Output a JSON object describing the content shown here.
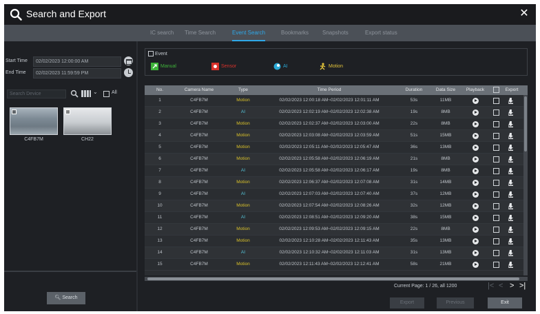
{
  "window": {
    "title": "Search and Export"
  },
  "tabs": [
    {
      "label": "IC search"
    },
    {
      "label": "Time Search"
    },
    {
      "label": "Event Search"
    },
    {
      "label": "Bookmarks"
    },
    {
      "label": "Snapshots"
    },
    {
      "label": "Export status"
    }
  ],
  "active_tab_index": 2,
  "filters": {
    "start_time_label": "Start Time",
    "start_time_value": "02/02/2023 12:00:00 AM",
    "end_time_label": "End Time",
    "end_time_value": "02/02/2023 11:59:59 PM",
    "search_placeholder": "Search Device",
    "all_label": "All"
  },
  "cameras": [
    {
      "name": "C4FB7M"
    },
    {
      "name": "CH22"
    }
  ],
  "search_button": "Search",
  "events": {
    "header": "Event",
    "items": [
      {
        "label": "Manual",
        "color": "#3fb43a"
      },
      {
        "label": "Sensor",
        "color": "#d8322b"
      },
      {
        "label": "AI",
        "color": "#2aa9d6"
      },
      {
        "label": "Motion",
        "color": "#e1c23a"
      }
    ]
  },
  "table": {
    "columns": [
      "No.",
      "Camera Name",
      "Type",
      "Time Period",
      "Duration",
      "Data Size",
      "Playback",
      "Export"
    ],
    "rows": [
      {
        "no": "1",
        "camera": "C4FB7M",
        "type": "Motion",
        "period": "02/02/2023 12:00:18 AM~02/02/2023 12:01:11 AM",
        "duration": "53s",
        "size": "11MB"
      },
      {
        "no": "2",
        "camera": "C4FB7M",
        "type": "AI",
        "period": "02/02/2023 12:02:19 AM~02/02/2023 12:02:38 AM",
        "duration": "19s",
        "size": "8MB"
      },
      {
        "no": "3",
        "camera": "C4FB7M",
        "type": "Motion",
        "period": "02/02/2023 12:02:37 AM~02/02/2023 12:03:00 AM",
        "duration": "22s",
        "size": "8MB"
      },
      {
        "no": "4",
        "camera": "C4FB7M",
        "type": "Motion",
        "period": "02/02/2023 12:03:08 AM~02/02/2023 12:03:59 AM",
        "duration": "51s",
        "size": "15MB"
      },
      {
        "no": "5",
        "camera": "C4FB7M",
        "type": "Motion",
        "period": "02/02/2023 12:05:11 AM~02/02/2023 12:05:47 AM",
        "duration": "36s",
        "size": "13MB"
      },
      {
        "no": "6",
        "camera": "C4FB7M",
        "type": "Motion",
        "period": "02/02/2023 12:05:58 AM~02/02/2023 12:06:19 AM",
        "duration": "21s",
        "size": "8MB"
      },
      {
        "no": "7",
        "camera": "C4FB7M",
        "type": "AI",
        "period": "02/02/2023 12:05:58 AM~02/02/2023 12:06:17 AM",
        "duration": "19s",
        "size": "8MB"
      },
      {
        "no": "8",
        "camera": "C4FB7M",
        "type": "Motion",
        "period": "02/02/2023 12:06:37 AM~02/02/2023 12:07:08 AM",
        "duration": "31s",
        "size": "14MB"
      },
      {
        "no": "9",
        "camera": "C4FB7M",
        "type": "AI",
        "period": "02/02/2023 12:07:03 AM~02/02/2023 12:07:40 AM",
        "duration": "37s",
        "size": "12MB"
      },
      {
        "no": "10",
        "camera": "C4FB7M",
        "type": "Motion",
        "period": "02/02/2023 12:07:54 AM~02/02/2023 12:08:26 AM",
        "duration": "32s",
        "size": "12MB"
      },
      {
        "no": "11",
        "camera": "C4FB7M",
        "type": "AI",
        "period": "02/02/2023 12:08:51 AM~02/02/2023 12:09:20 AM",
        "duration": "38s",
        "size": "15MB"
      },
      {
        "no": "12",
        "camera": "C4FB7M",
        "type": "Motion",
        "period": "02/02/2023 12:09:53 AM~02/02/2023 12:09:15 AM",
        "duration": "22s",
        "size": "8MB"
      },
      {
        "no": "13",
        "camera": "C4FB7M",
        "type": "Motion",
        "period": "02/02/2023 12:10:28 AM~02/02/2023 12:11:43 AM",
        "duration": "35s",
        "size": "13MB"
      },
      {
        "no": "14",
        "camera": "C4FB7M",
        "type": "AI",
        "period": "02/02/2023 12:10:32 AM~02/02/2023 12:11:03 AM",
        "duration": "31s",
        "size": "13MB"
      },
      {
        "no": "15",
        "camera": "C4FB7M",
        "type": "Motion",
        "period": "02/02/2023 12:11:43 AM~02/02/2023 12:12:41 AM",
        "duration": "58s",
        "size": "21MB"
      }
    ]
  },
  "pagination": {
    "text": "Current Page: 1 / 26, all 1200"
  },
  "buttons": {
    "export": "Export",
    "previous": "Previous",
    "exit": "Exit"
  }
}
